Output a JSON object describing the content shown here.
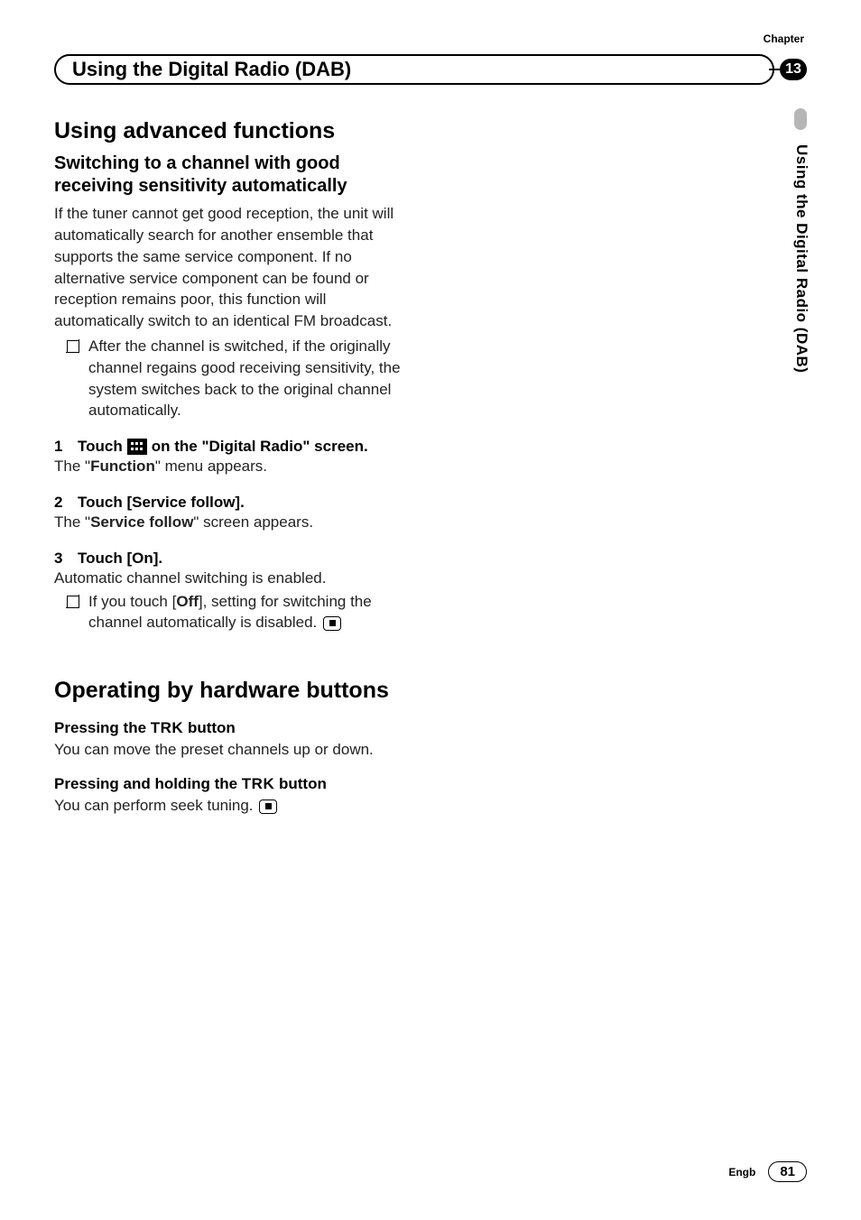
{
  "chapter_label": "Chapter",
  "chapter_number": "13",
  "header_title": "Using the Digital Radio (DAB)",
  "side_tab": "Using the Digital Radio (DAB)",
  "section1": {
    "title": "Using advanced functions",
    "subtitle": "Switching to a channel with good receiving sensitivity automatically",
    "intro": "If the tuner cannot get good reception, the unit will automatically search for another ensemble that supports the same service component. If no alternative service component can be found or reception remains poor, this function will automatically switch to an identical FM broadcast.",
    "bullet1": "After the channel is switched, if the originally channel regains good receiving sensitivity, the system switches back to the original channel automatically.",
    "step1": {
      "num": "1",
      "pre": "Touch",
      "post": "on the \"Digital Radio\" screen.",
      "desc_pre": "The \"",
      "desc_bold": "Function",
      "desc_post": "\" menu appears."
    },
    "step2": {
      "num": "2",
      "head": "Touch [Service follow].",
      "desc_pre": "The \"",
      "desc_bold": "Service follow",
      "desc_post": "\" screen appears."
    },
    "step3": {
      "num": "3",
      "head": "Touch [On].",
      "desc": "Automatic channel switching is enabled.",
      "bullet_pre": "If you touch [",
      "bullet_bold": "Off",
      "bullet_post": "], setting for switching the channel automatically is disabled."
    }
  },
  "section2": {
    "title": "Operating by hardware buttons",
    "h1_pre": "Pressing the ",
    "h1_trk": "TRK",
    "h1_post": " button",
    "p1": "You can move the preset channels up or down.",
    "h2_pre": "Pressing and holding the ",
    "h2_trk": "TRK",
    "h2_post": " button",
    "p2": "You can perform seek tuning."
  },
  "footer": {
    "lang": "Engb",
    "page": "81"
  }
}
